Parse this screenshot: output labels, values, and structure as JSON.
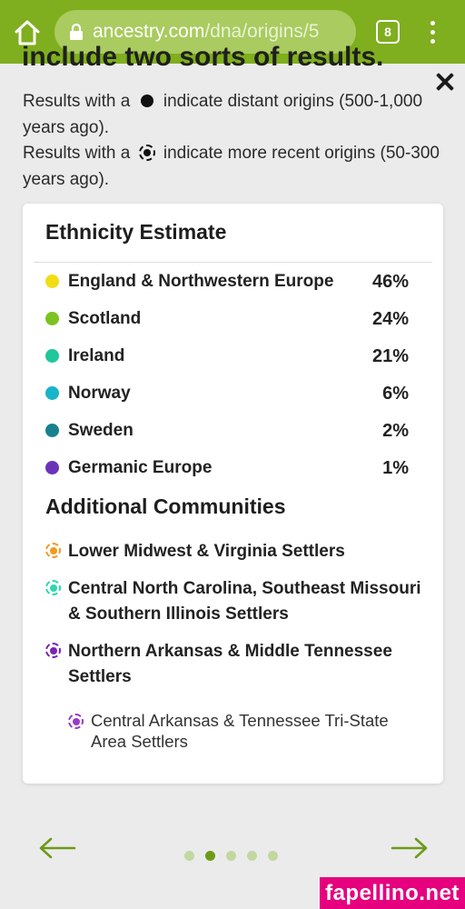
{
  "browser": {
    "url_host": "ancestry.com",
    "url_path": "/dna/origins/5",
    "tab_count": "8",
    "theme_color": "#7fae1e"
  },
  "page": {
    "cut_heading": "include two sorts of results.",
    "legend_line1_prefix": "Results with a",
    "legend_line1_suffix": "indicate distant origins (500-1,000 years ago).",
    "legend_line2_prefix": "Results with a",
    "legend_line2_suffix": "indicate more recent origins (50-300 years ago)."
  },
  "card": {
    "title": "Ethnicity Estimate",
    "ethnicities": [
      {
        "name": "England & Northwestern Europe",
        "percent": "46%",
        "color": "#f2dc14"
      },
      {
        "name": "Scotland",
        "percent": "24%",
        "color": "#7cc31f"
      },
      {
        "name": "Ireland",
        "percent": "21%",
        "color": "#1fc79a"
      },
      {
        "name": "Norway",
        "percent": "6%",
        "color": "#17b5c9"
      },
      {
        "name": "Sweden",
        "percent": "2%",
        "color": "#18808e"
      },
      {
        "name": "Germanic Europe",
        "percent": "1%",
        "color": "#6b32b8"
      }
    ],
    "communities_title": "Additional Communities",
    "communities": [
      {
        "name": "Lower Midwest & Virginia Settlers",
        "color": "#f39a1e"
      },
      {
        "name": "Central North Carolina, Southeast Missouri & Southern Illinois Settlers",
        "color": "#2fd6ae"
      },
      {
        "name": "Northern Arkansas & Middle Tennessee Settlers",
        "color": "#7a22b5"
      },
      {
        "name": "Central Arkansas & Tennessee Tri-State Area Settlers",
        "color": "#9b3ac4"
      }
    ]
  },
  "nav": {
    "pages_total": 5,
    "active_page": 2,
    "arrow_color": "#6c9b1b"
  },
  "watermark": "fapellino.net"
}
